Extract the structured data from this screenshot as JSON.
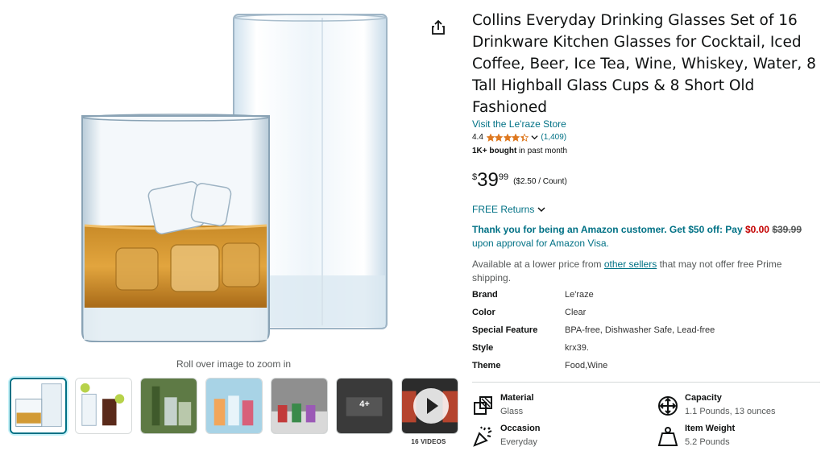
{
  "product": {
    "title": "Collins Everyday Drinking Glasses Set of 16 Drinkware Kitchen Glasses for Cocktail, Iced Coffee, Beer, Ice Tea, Wine, Whiskey, Water, 8 Tall Highball Glass Cups & 8 Short Old Fashioned",
    "store_link": "Visit the Le'raze Store",
    "rating": "4.4",
    "rating_value": 4.4,
    "review_count": "(1,409)",
    "bought_strong": "1K+ bought",
    "bought_rest": " in past month"
  },
  "price": {
    "symbol": "$",
    "whole": "39",
    "fraction": "99",
    "per_unit": "($2.50 / Count)"
  },
  "returns": {
    "label": "FREE Returns"
  },
  "promo": {
    "bold_text": "Thank you for being an Amazon customer. Get $50 off: Pay ",
    "new_price": "$0.00",
    "old_price": "$39.99",
    "tail": " upon approval for Amazon Visa."
  },
  "other_sellers": {
    "prefix": "Available at a lower price from ",
    "link": "other sellers",
    "suffix": " that may not offer free Prime shipping."
  },
  "specs": [
    {
      "key": "Brand",
      "value": "Le'raze"
    },
    {
      "key": "Color",
      "value": "Clear"
    },
    {
      "key": "Special Feature",
      "value": "BPA-free, Dishwasher Safe, Lead-free"
    },
    {
      "key": "Style",
      "value": "krx39."
    },
    {
      "key": "Theme",
      "value": "Food,Wine"
    }
  ],
  "features": [
    {
      "label": "Material",
      "value": "Glass",
      "icon": "material-icon"
    },
    {
      "label": "Capacity",
      "value": "1.1 Pounds, 13 ounces",
      "icon": "capacity-icon"
    },
    {
      "label": "Occasion",
      "value": "Everyday",
      "icon": "occasion-icon"
    },
    {
      "label": "Item Weight",
      "value": "5.2 Pounds",
      "icon": "weight-icon"
    }
  ],
  "gallery": {
    "zoom_hint": "Roll over image to zoom in",
    "more_count": "4+",
    "videos_label": "16 VIDEOS",
    "thumbnail_count": 7,
    "selected_index": 0
  },
  "colors": {
    "link": "#007185",
    "price_red": "#c40000",
    "star": "#de7921",
    "selected_border": "#007185"
  }
}
